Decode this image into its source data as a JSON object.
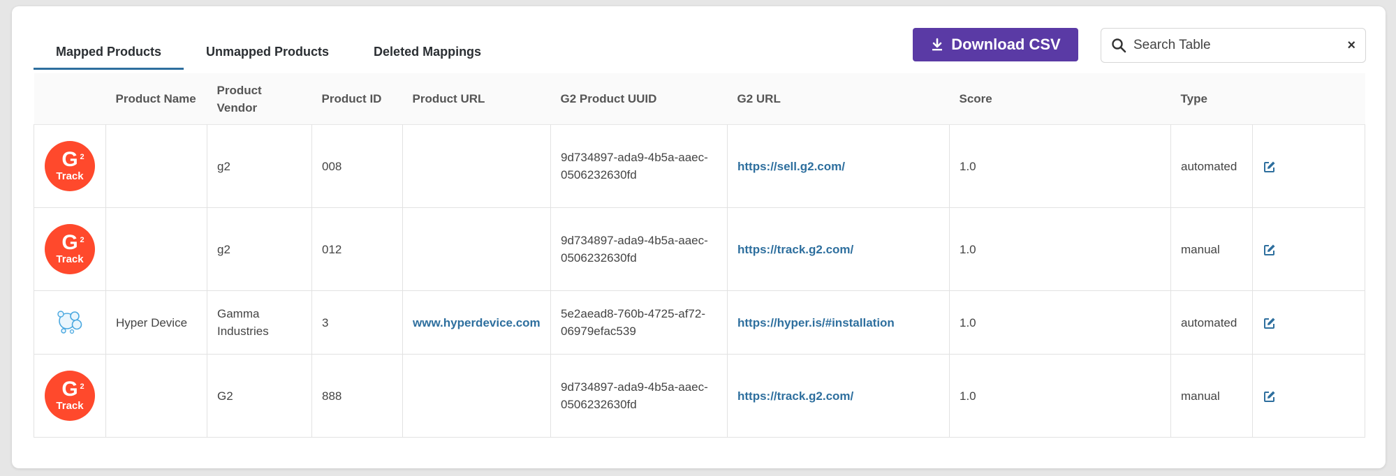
{
  "tabs": [
    {
      "label": "Mapped Products",
      "active": true
    },
    {
      "label": "Unmapped Products",
      "active": false
    },
    {
      "label": "Deleted Mappings",
      "active": false
    }
  ],
  "toolbar": {
    "download_label": "Download CSV",
    "download_icon": "download-icon",
    "search_placeholder": "Search Table",
    "search_value": "",
    "clear_label": "×",
    "accent_color": "#5a3aa5"
  },
  "table": {
    "columns": [
      "",
      "Product Name",
      "Product Vendor",
      "Product ID",
      "Product URL",
      "G2 Product UUID",
      "G2 URL",
      "Score",
      "Type",
      ""
    ],
    "rows": [
      {
        "logo": "g2-track",
        "logo_text": "Track",
        "name": "",
        "vendor": "g2",
        "id": "008",
        "url": "",
        "uuid": "9d734897-ada9-4b5a-aaec-0506232630fd",
        "g2_url": "https://sell.g2.com/",
        "score": "1.0",
        "type": "automated"
      },
      {
        "logo": "g2-track",
        "logo_text": "Track",
        "name": "",
        "vendor": "g2",
        "id": "012",
        "url": "",
        "uuid": "9d734897-ada9-4b5a-aaec-0506232630fd",
        "g2_url": "https://track.g2.com/",
        "score": "1.0",
        "type": "manual"
      },
      {
        "logo": "hyper-device",
        "logo_text": "",
        "name": "Hyper Device",
        "vendor": "Gamma Industries",
        "id": "3",
        "url": "www.hyperdevice.com",
        "uuid": "5e2aead8-760b-4725-af72-06979efac539",
        "g2_url": "https://hyper.is/#installation",
        "score": "1.0",
        "type": "automated"
      },
      {
        "logo": "g2-track",
        "logo_text": "Track",
        "name": "",
        "vendor": "G2",
        "id": "888",
        "url": "",
        "uuid": "9d734897-ada9-4b5a-aaec-0506232630fd",
        "g2_url": "https://track.g2.com/",
        "score": "1.0",
        "type": "manual"
      }
    ]
  },
  "colors": {
    "link": "#2e6f9e",
    "g2_logo": "#ff492c",
    "tab_underline": "#2e6f9e"
  }
}
